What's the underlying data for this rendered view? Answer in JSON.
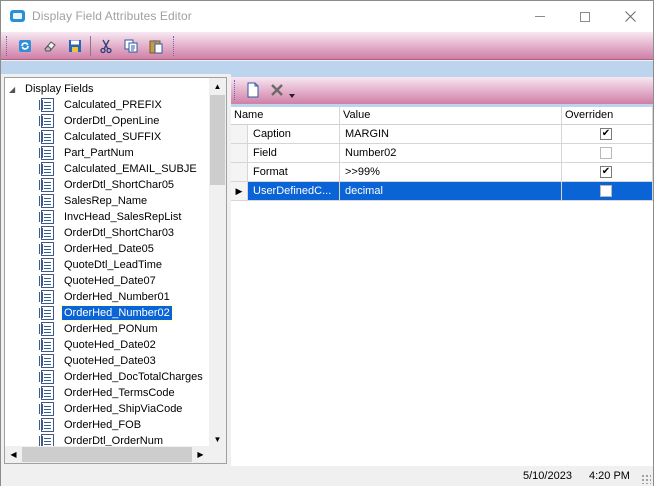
{
  "window": {
    "title": "Display Field Attributes Editor"
  },
  "toolbar": {
    "buttons": [
      {
        "icon": "refresh-icon"
      },
      {
        "icon": "eraser-icon"
      },
      {
        "icon": "save-icon"
      },
      {
        "icon": "cut-icon"
      },
      {
        "icon": "copy-icon"
      },
      {
        "icon": "paste-icon"
      }
    ]
  },
  "tree": {
    "root_label": "Display Fields",
    "items": [
      "Calculated_PREFIX",
      "OrderDtl_OpenLine",
      "Calculated_SUFFIX",
      "Part_PartNum",
      "Calculated_EMAIL_SUBJE",
      "OrderDtl_ShortChar05",
      "SalesRep_Name",
      "InvcHead_SalesRepList",
      "OrderDtl_ShortChar03",
      "OrderHed_Date05",
      "QuoteDtl_LeadTime",
      "QuoteHed_Date07",
      "OrderHed_Number01",
      "OrderHed_Number02",
      "OrderHed_PONum",
      "QuoteHed_Date02",
      "QuoteHed_Date03",
      "OrderHed_DocTotalCharges",
      "OrderHed_TermsCode",
      "OrderHed_ShipViaCode",
      "OrderHed_FOB",
      "OrderDtl_OrderNum"
    ],
    "selected": "OrderHed_Number02"
  },
  "grid": {
    "columns": {
      "name": "Name",
      "value": "Value",
      "overriden": "Overriden"
    },
    "rows": [
      {
        "name": "Caption",
        "value": "MARGIN",
        "overriden": true
      },
      {
        "name": "Field",
        "value": "Number02",
        "overriden": false
      },
      {
        "name": "Format",
        "value": ">>99%",
        "overriden": true
      },
      {
        "name": "UserDefinedC...",
        "value": "decimal",
        "overriden": false
      }
    ],
    "active_row": 3
  },
  "status": {
    "date": "5/10/2023",
    "time": "4:20 PM"
  },
  "colors": {
    "selection": "#0a64d6",
    "toolbar_pink": "#cf7fa6",
    "banner_blue": "#bcd4ee"
  }
}
